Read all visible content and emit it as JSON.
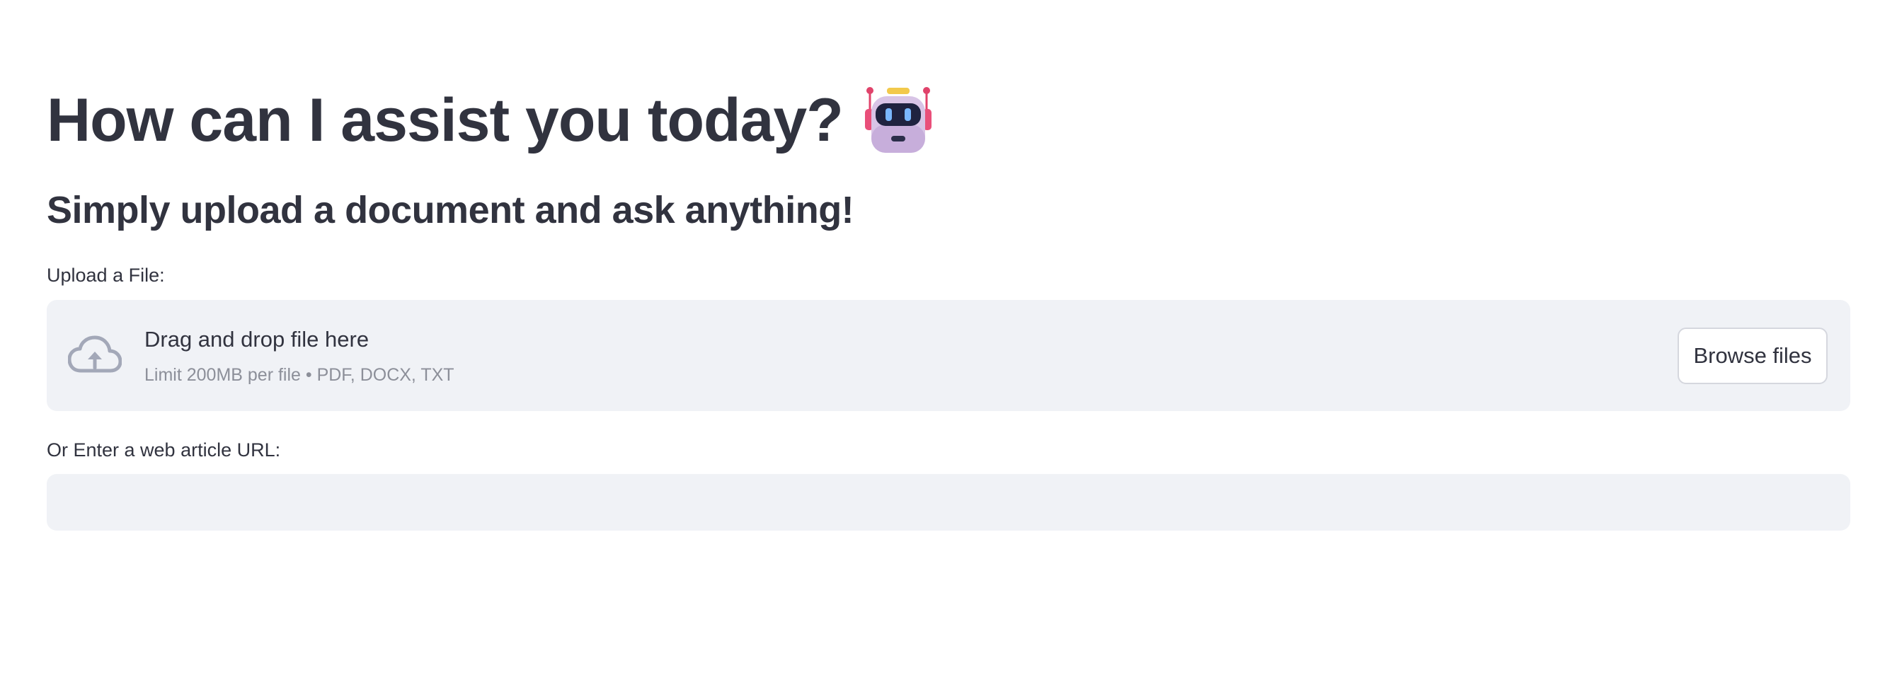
{
  "header": {
    "title": "How can I assist you today?",
    "title_icon": "robot-icon",
    "subtitle": "Simply upload a document and ask anything!"
  },
  "upload": {
    "label": "Upload a File:",
    "dropzone_text": "Drag and drop file here",
    "limit_text": "Limit 200MB per file • PDF, DOCX, TXT",
    "icon": "cloud-upload-icon",
    "browse_label": "Browse files"
  },
  "url_input": {
    "label": "Or Enter a web article URL:",
    "value": ""
  },
  "colors": {
    "text": "#31333f",
    "muted_text": "#8c8f99",
    "input_background": "#f0f2f6",
    "icon_gray": "#a3a8b8"
  }
}
